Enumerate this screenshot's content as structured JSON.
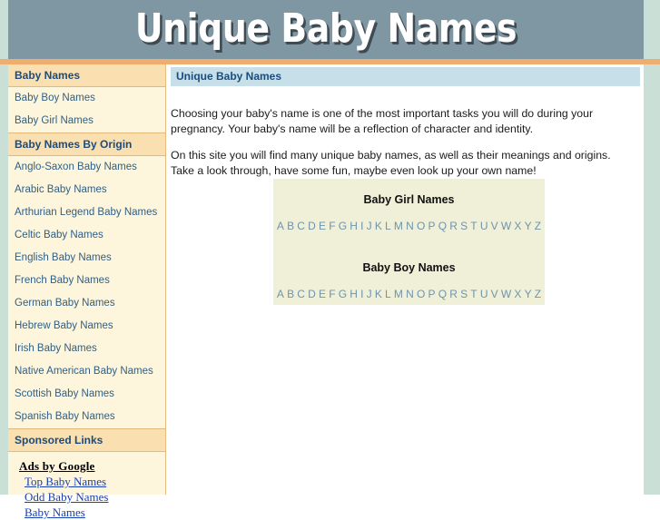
{
  "site": {
    "banner_title": "Unique Baby Names"
  },
  "sidebar": {
    "sections": [
      {
        "heading": "Baby Names",
        "links": [
          "Baby Boy Names",
          "Baby Girl Names"
        ]
      },
      {
        "heading": "Baby Names By Origin",
        "links": [
          "Anglo-Saxon Baby Names",
          "Arabic Baby Names",
          "Arthurian Legend Baby Names",
          "Celtic Baby Names",
          "English Baby Names",
          "French Baby Names",
          "German Baby Names",
          "Hebrew Baby Names",
          "Irish Baby Names",
          "Native American Baby Names",
          "Scottish Baby Names",
          "Spanish Baby Names"
        ]
      }
    ],
    "sponsored": {
      "heading": "Sponsored Links",
      "ads_label": "Ads by Google",
      "ads": [
        "Top Baby Names",
        "Odd Baby Names",
        "Baby Names"
      ]
    }
  },
  "main": {
    "title": "Unique Baby Names",
    "paragraph_1": "Choosing your baby's name is one of the most important tasks you will do during your pregnancy. Your baby's name will be a reflection of character and identity.",
    "paragraph_2": "On this site you will find many unique baby names, as well as their meanings and origins. Take a look through, have some fun, maybe even look up your own name!",
    "alphabet_panel": {
      "girl_heading": "Baby Girl Names",
      "boy_heading": "Baby Boy Names",
      "letters": [
        "A",
        "B",
        "C",
        "D",
        "E",
        "F",
        "G",
        "H",
        "I",
        "J",
        "K",
        "L",
        "M",
        "N",
        "O",
        "P",
        "Q",
        "R",
        "S",
        "T",
        "U",
        "V",
        "W",
        "X",
        "Y",
        "Z"
      ]
    }
  },
  "colors": {
    "banner_bg": "#7f97a3",
    "edge_strip": "#cadfd5",
    "orange_bar": "#efad6f",
    "sidebar_item_bg": "#fdf6dd",
    "sidebar_head_bg": "#fadfb0",
    "title_bar_bg": "#c6dfe8",
    "heading_text": "#1b4c7d",
    "alpha_panel_bg": "#f0f0d8",
    "alpha_letter": "#6f94ab"
  }
}
